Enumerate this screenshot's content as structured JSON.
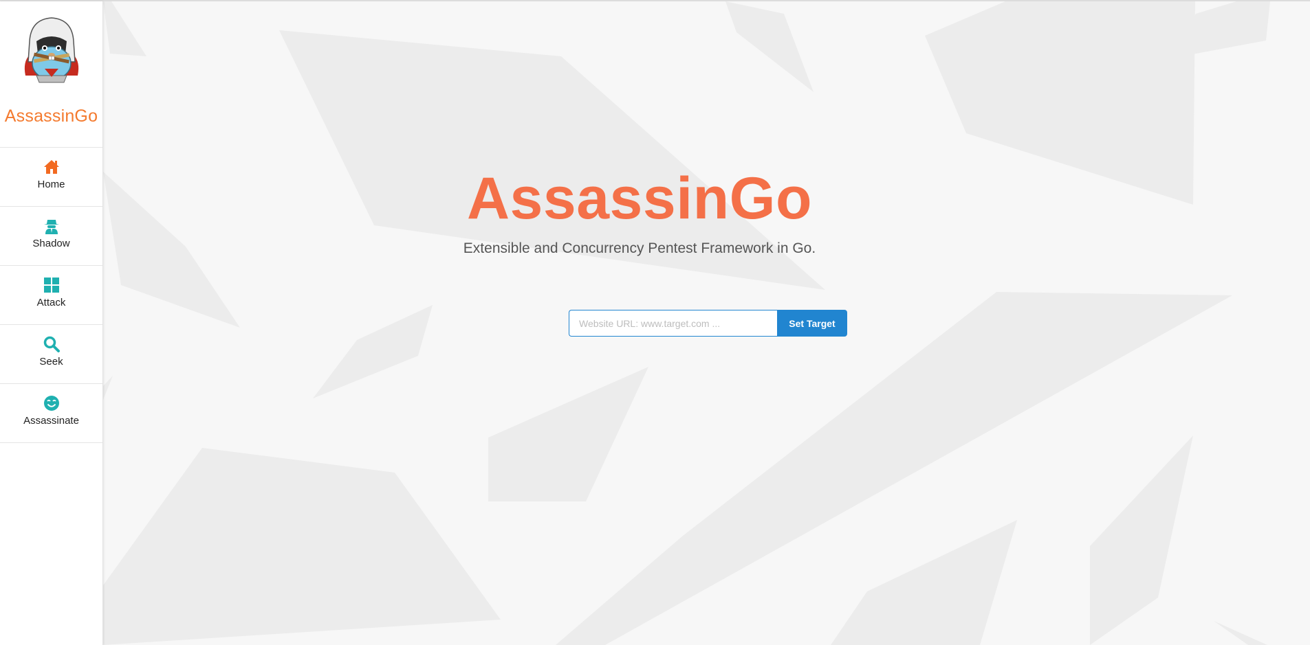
{
  "colors": {
    "brand": "#f47a2e",
    "hero_title": "#f47048",
    "nav_teal": "#1fb0b0",
    "nav_orange": "#f26a21",
    "button": "#2185d0",
    "shape": "#ececec"
  },
  "sidebar": {
    "brand": "AssassinGo",
    "items": [
      {
        "label": "Home",
        "icon": "home-icon"
      },
      {
        "label": "Shadow",
        "icon": "spy-icon"
      },
      {
        "label": "Attack",
        "icon": "grid-icon"
      },
      {
        "label": "Seek",
        "icon": "search-icon"
      },
      {
        "label": "Assassinate",
        "icon": "smile-icon"
      }
    ]
  },
  "hero": {
    "title": "AssassinGo",
    "subtitle": "Extensible and Concurrency Pentest Framework in Go."
  },
  "target_form": {
    "placeholder": "Website URL: www.target.com ...",
    "value": "",
    "button_label": "Set Target"
  }
}
